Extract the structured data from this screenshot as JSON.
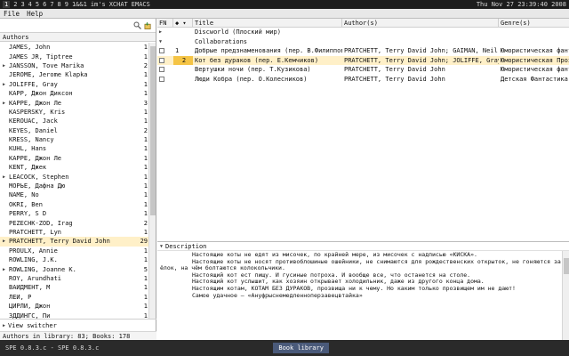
{
  "topbar": {
    "workspaces": [
      "1",
      "2",
      "3",
      "4",
      "5",
      "6",
      "7",
      "8",
      "9",
      "1&&1",
      "im's",
      "XCHAT",
      "EMACS"
    ],
    "clock": "Thu Nov 27 23:39:40 2008"
  },
  "menu": {
    "file": "File",
    "help": "Help"
  },
  "authors": {
    "header": "Authors",
    "rows": [
      {
        "name": "JAMES, John",
        "count": "1",
        "expand": false
      },
      {
        "name": "JAMES JR, Tiptree",
        "count": "1",
        "expand": false
      },
      {
        "name": "JANSSON, Tove Marika",
        "count": "2",
        "expand": true
      },
      {
        "name": "JEROME, Jerome Klapka",
        "count": "1",
        "expand": false
      },
      {
        "name": "JOLIFFE, Gray",
        "count": "1",
        "expand": true
      },
      {
        "name": "KAPP, Джон Диксон",
        "count": "1",
        "expand": false
      },
      {
        "name": "KAPPE, Джон Ле",
        "count": "3",
        "expand": true
      },
      {
        "name": "KASPERSKY, Kris",
        "count": "1",
        "expand": false
      },
      {
        "name": "KEROUAC, Jack",
        "count": "1",
        "expand": false
      },
      {
        "name": "KEYES, Daniel",
        "count": "2",
        "expand": false
      },
      {
        "name": "KRESS, Nancy",
        "count": "1",
        "expand": false
      },
      {
        "name": "KUHL, Hans",
        "count": "1",
        "expand": false
      },
      {
        "name": "KAPPE, Джон Ле",
        "count": "1",
        "expand": false
      },
      {
        "name": "KENT, Джек",
        "count": "1",
        "expand": false
      },
      {
        "name": "LEACOCK, Stephen",
        "count": "1",
        "expand": true
      },
      {
        "name": "МОРЬЕ, Дафна Дю",
        "count": "1",
        "expand": false
      },
      {
        "name": "NAME, No",
        "count": "1",
        "expand": false
      },
      {
        "name": "OKRI, Ben",
        "count": "1",
        "expand": false
      },
      {
        "name": "PERRY, S D",
        "count": "1",
        "expand": false
      },
      {
        "name": "PEZECHK-ZOD, Irag",
        "count": "2",
        "expand": false
      },
      {
        "name": "PRATCHETT, Lyn",
        "count": "1",
        "expand": false
      },
      {
        "name": "PRATCHETT, Terry David John",
        "count": "29",
        "expand": true,
        "selected": true
      },
      {
        "name": "PROULX, Annie",
        "count": "1",
        "expand": false
      },
      {
        "name": "ROWLING, J.K.",
        "count": "1",
        "expand": false
      },
      {
        "name": "ROWLING, Joanne K.",
        "count": "5",
        "expand": true
      },
      {
        "name": "ROY, Arundhati",
        "count": "1",
        "expand": false
      },
      {
        "name": "ВАЙДМЕНТ, М",
        "count": "1",
        "expand": false
      },
      {
        "name": "ЛЕЙ, Р",
        "count": "1",
        "expand": false
      },
      {
        "name": "ЦИРЛИ, Джон",
        "count": "1",
        "expand": false
      },
      {
        "name": "ЗДДИНГС, Пи",
        "count": "1",
        "expand": false
      }
    ]
  },
  "view_switcher": "View switcher",
  "status": "Authors in library: 83; Books: 178",
  "books": {
    "columns": {
      "fn": "FN",
      "title": "Title",
      "author": "Author(s)",
      "genre": "Genre(s)"
    },
    "rows": [
      {
        "kind": "group",
        "title": "Discworld (Плоский мир)",
        "tri": "▶"
      },
      {
        "kind": "group",
        "title": "Collaborations",
        "tri": "▼"
      },
      {
        "kind": "book",
        "sort": "1",
        "title": "Добрые предзнаменования (пер. В.Филиппов)",
        "author": "PRATCHETT, Terry David John; GAIMAN, Neil",
        "genre": "Юмористическая фант"
      },
      {
        "kind": "book",
        "sort": "2",
        "title": "Кот без дураков (пер. Е.Кемчиков)",
        "author": "PRATCHETT, Terry David John; JOLIFFE, Gray",
        "genre": "Юмористическая Проз",
        "selected": true
      },
      {
        "kind": "book",
        "sort": "",
        "title": "Вертушки ночи (пер. Т.Кузикова)",
        "author": "PRATCHETT, Terry David John",
        "genre": "Юмористическая фант"
      },
      {
        "kind": "book",
        "sort": "",
        "title": "Люди Кобра (пер. О.Колесников)",
        "author": "PRATCHETT, Terry David John",
        "genre": "Детская Фантастика"
      }
    ]
  },
  "description": {
    "header": "Description",
    "lines": [
      {
        "text": "Настоящие коты не едят из мисочек, по крайней мере, из мисочек с надписью «КИСКА».",
        "indent": true
      },
      {
        "text": "Настоящие коты не носят противоблошиные ошейники, не снимаются для рождественских открыток, не гоняются за",
        "indent": true
      },
      {
        "text": "ёлок, на чём болтаются колокольчики.",
        "indent": false
      },
      {
        "text": "Настоящий кот ест пищу. И гусиные потроха. И вообще все, что останется на столе.",
        "indent": true
      },
      {
        "text": "Настоящий кот услышит, как хозяин открывает холодильник, даже из другого конца дома.",
        "indent": true
      },
      {
        "text": "Настоящим котам, КОТАМ БЕЗ ДУРАКОВ, прозвища ни к чему. Но каким только прозвищем им не дают!",
        "indent": true
      },
      {
        "text": "Самое удачное — «Ануфрыснемедленноперзавецвтайка»",
        "indent": true
      }
    ]
  },
  "taskbar": {
    "left": "SPE 0.8.3.c - SPE 0.8.3.c",
    "active": "Book library"
  }
}
